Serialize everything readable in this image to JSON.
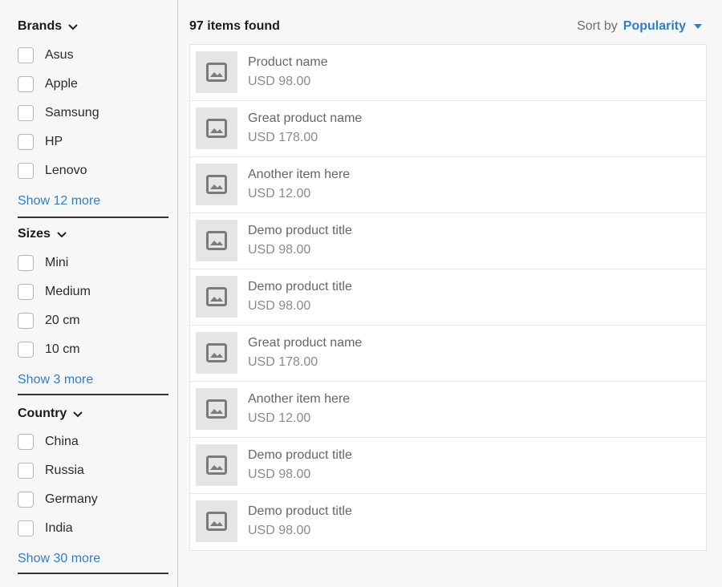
{
  "sidebar": {
    "groups": [
      {
        "title": "Brands",
        "options": [
          "Asus",
          "Apple",
          "Samsung",
          "HP",
          "Lenovo"
        ],
        "show_more": "Show 12 more"
      },
      {
        "title": "Sizes",
        "options": [
          "Mini",
          "Medium",
          "20 cm",
          "10 cm"
        ],
        "show_more": "Show 3 more"
      },
      {
        "title": "Country",
        "options": [
          "China",
          "Russia",
          "Germany",
          "India"
        ],
        "show_more": "Show 30 more"
      }
    ]
  },
  "results": {
    "count_text": "97 items found",
    "sort_label": "Sort by",
    "sort_value": "Popularity"
  },
  "products": [
    {
      "name": "Product name",
      "price": "USD 98.00"
    },
    {
      "name": "Great product name",
      "price": "USD 178.00"
    },
    {
      "name": "Another item here",
      "price": "USD 12.00"
    },
    {
      "name": "Demo product title",
      "price": "USD 98.00"
    },
    {
      "name": "Demo product title",
      "price": "USD 98.00"
    },
    {
      "name": "Great product name",
      "price": "USD 178.00"
    },
    {
      "name": "Another item here",
      "price": "USD 12.00"
    },
    {
      "name": "Demo product title",
      "price": "USD 98.00"
    },
    {
      "name": "Demo product title",
      "price": "USD 98.00"
    }
  ],
  "icons": {
    "chevron": "chevron-down-icon",
    "sort_caret": "caret-down-icon",
    "thumbnail": "image-placeholder-icon"
  },
  "colors": {
    "accent": "#2d7fc4",
    "thumb_bg": "#e5e5e5",
    "page_bg": "#f7f7f7"
  }
}
